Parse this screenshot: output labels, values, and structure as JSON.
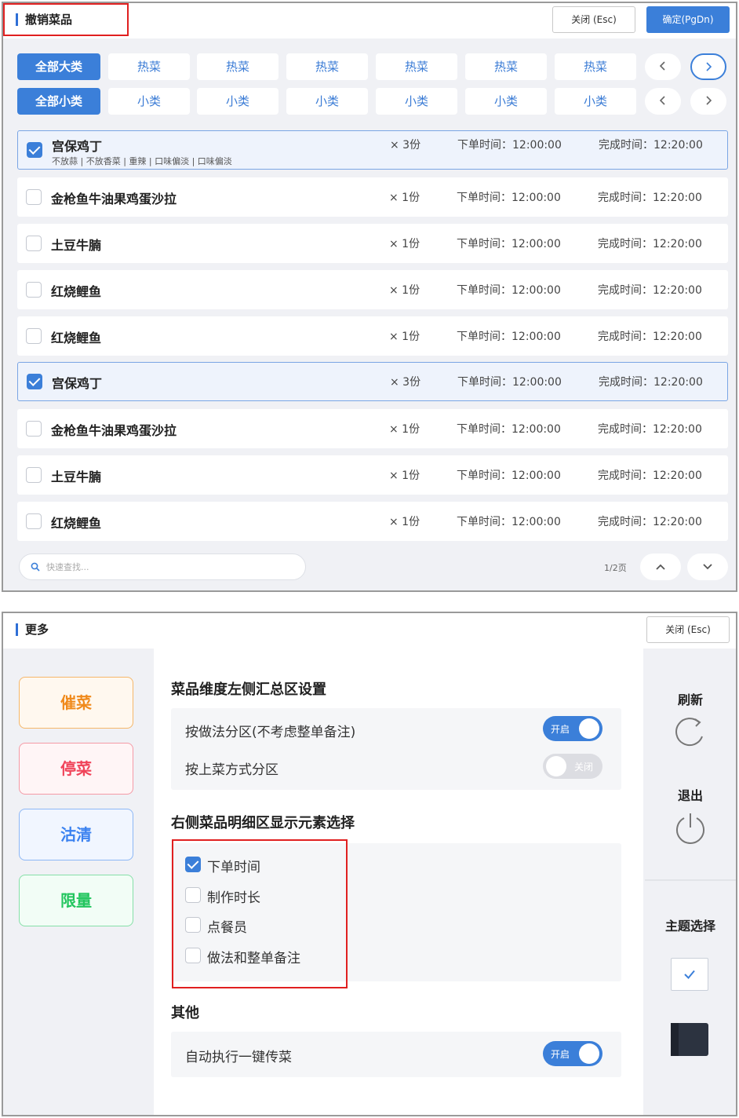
{
  "cancel_dialog": {
    "title": "撤销菜品",
    "close_label": "关闭 (Esc)",
    "confirm_label": "确定(PgDn)",
    "big_categories": {
      "all_label": "全部大类",
      "items": [
        "热菜",
        "热菜",
        "热菜",
        "热菜",
        "热菜",
        "热菜"
      ]
    },
    "small_categories": {
      "all_label": "全部小类",
      "items": [
        "小类",
        "小类",
        "小类",
        "小类",
        "小类",
        "小类"
      ]
    },
    "rows": [
      {
        "name": "宫保鸡丁",
        "note": "不放蒜 | 不放香菜 | 重辣 | 口味偏淡 | 口味偏淡",
        "qty": "× 3份",
        "order_time": "下单时间：12:00:00",
        "finish_time": "完成时间：12:20:00",
        "checked": true
      },
      {
        "name": "金枪鱼牛油果鸡蛋沙拉",
        "note": "",
        "qty": "× 1份",
        "order_time": "下单时间：12:00:00",
        "finish_time": "完成时间：12:20:00",
        "checked": false
      },
      {
        "name": "土豆牛腩",
        "note": "",
        "qty": "× 1份",
        "order_time": "下单时间：12:00:00",
        "finish_time": "完成时间：12:20:00",
        "checked": false
      },
      {
        "name": "红烧鲤鱼",
        "note": "",
        "qty": "× 1份",
        "order_time": "下单时间：12:00:00",
        "finish_time": "完成时间：12:20:00",
        "checked": false
      },
      {
        "name": "红烧鲤鱼",
        "note": "",
        "qty": "× 1份",
        "order_time": "下单时间：12:00:00",
        "finish_time": "完成时间：12:20:00",
        "checked": false
      },
      {
        "name": "宫保鸡丁",
        "note": "",
        "qty": "× 3份",
        "order_time": "下单时间：12:00:00",
        "finish_time": "完成时间：12:20:00",
        "checked": true
      },
      {
        "name": "金枪鱼牛油果鸡蛋沙拉",
        "note": "",
        "qty": "× 1份",
        "order_time": "下单时间：12:00:00",
        "finish_time": "完成时间：12:20:00",
        "checked": false
      },
      {
        "name": "土豆牛腩",
        "note": "",
        "qty": "× 1份",
        "order_time": "下单时间：12:00:00",
        "finish_time": "完成时间：12:20:00",
        "checked": false
      },
      {
        "name": "红烧鲤鱼",
        "note": "",
        "qty": "× 1份",
        "order_time": "下单时间：12:00:00",
        "finish_time": "完成时间：12:20:00",
        "checked": false
      }
    ],
    "search_placeholder": "快速查找...",
    "page_indicator": "1/2页"
  },
  "more_dialog": {
    "title": "更多",
    "close_label": "关闭 (Esc)",
    "side_buttons": [
      {
        "label": "催菜",
        "color": "#f08a1c"
      },
      {
        "label": "停菜",
        "color": "#f0445a"
      },
      {
        "label": "沽清",
        "color": "#3b82f0"
      },
      {
        "label": "限量",
        "color": "#22c55e"
      }
    ],
    "section1_title": "菜品维度左侧汇总区设置",
    "section1_options": [
      {
        "label": "按做法分区(不考虑整单备注)",
        "toggle": "开启",
        "on": true
      },
      {
        "label": "按上菜方式分区",
        "toggle": "关闭",
        "on": false
      }
    ],
    "section2_title": "右侧菜品明细区显示元素选择",
    "section2_checks": [
      {
        "label": "下单时间",
        "checked": true
      },
      {
        "label": "制作时长",
        "checked": false
      },
      {
        "label": "点餐员",
        "checked": false
      },
      {
        "label": "做法和整单备注",
        "checked": false
      }
    ],
    "section3_title": "其他",
    "section3_options": [
      {
        "label": "自动执行一键传菜",
        "toggle": "开启",
        "on": true
      }
    ],
    "refresh_label": "刷新",
    "exit_label": "退出",
    "theme_label": "主题选择"
  },
  "colors": {
    "accent": "#3b7fd9",
    "highlight_box": "#e02020"
  }
}
